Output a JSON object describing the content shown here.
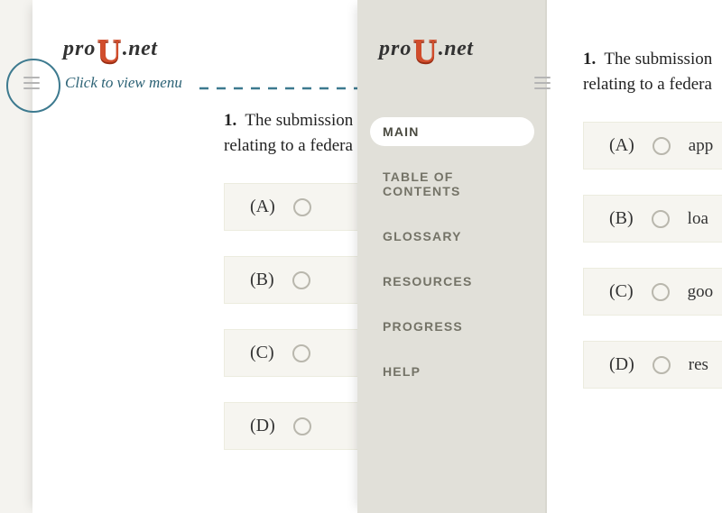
{
  "brand": {
    "pro": "pro",
    "u": "U",
    "net": ".net"
  },
  "annotation": {
    "label": "Click to view menu"
  },
  "question": {
    "number": "1.",
    "line1": "The submission",
    "line2": "relating to a federa"
  },
  "options_left": [
    {
      "letter": "(A)"
    },
    {
      "letter": "(B)"
    },
    {
      "letter": "(C)"
    },
    {
      "letter": "(D)"
    }
  ],
  "options_right": [
    {
      "letter": "(A)",
      "text": "app"
    },
    {
      "letter": "(B)",
      "text": "loa"
    },
    {
      "letter": "(C)",
      "text": "goo"
    },
    {
      "letter": "(D)",
      "text": "res"
    }
  ],
  "menu": {
    "items": [
      {
        "label": "MAIN",
        "active": true
      },
      {
        "label": "TABLE OF CONTENTS",
        "active": false
      },
      {
        "label": "GLOSSARY",
        "active": false
      },
      {
        "label": "RESOURCES",
        "active": false
      },
      {
        "label": "PROGRESS",
        "active": false
      },
      {
        "label": "HELP",
        "active": false
      }
    ]
  }
}
